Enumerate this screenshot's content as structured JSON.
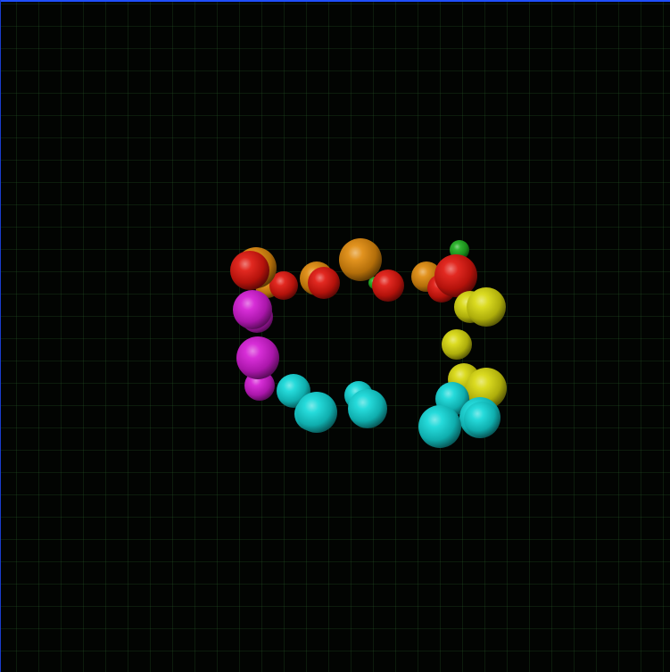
{
  "scene": {
    "background": "#000000",
    "grid_color": "#1e3a1e",
    "border_color": "#1f4fff",
    "sphere_colors": {
      "red": "#e0160e",
      "orange": "#e08a0c",
      "green": "#1fae1f",
      "yellow": "#d8d80e",
      "cyan": "#13d8d8",
      "magenta": "#d41cd4"
    },
    "spheres_back_to_front": [
      "green",
      "green",
      "orange",
      "red",
      "orange",
      "orange",
      "red",
      "red",
      "orange",
      "orange",
      "red",
      "red",
      "red",
      "magenta",
      "magenta",
      "magenta",
      "magenta",
      "yellow",
      "yellow",
      "yellow",
      "yellow",
      "yellow",
      "cyan",
      "cyan",
      "cyan",
      "cyan",
      "cyan",
      "cyan",
      "cyan",
      "cyan",
      "cyan"
    ]
  }
}
